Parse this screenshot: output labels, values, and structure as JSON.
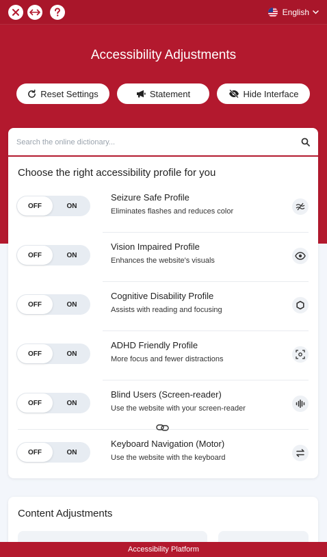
{
  "header": {
    "language_label": "English"
  },
  "title": "Accessibility Adjustments",
  "actions": {
    "reset_label": "Reset Settings",
    "statement_label": "Statement",
    "hide_label": "Hide Interface"
  },
  "search": {
    "placeholder": "Search the online dictionary..."
  },
  "profiles_section": {
    "title": "Choose the right accessibility profile for you",
    "profiles": [
      {
        "title": "Seizure Safe Profile",
        "description": "Eliminates flashes and reduces color",
        "off_label": "OFF",
        "on_label": "ON",
        "icon": "waves-icon"
      },
      {
        "title": "Vision Impaired Profile",
        "description": "Enhances the website's visuals",
        "off_label": "OFF",
        "on_label": "ON",
        "icon": "eye-icon"
      },
      {
        "title": "Cognitive Disability Profile",
        "description": "Assists with reading and focusing",
        "off_label": "OFF",
        "on_label": "ON",
        "icon": "circle-icon"
      },
      {
        "title": "ADHD Friendly Profile",
        "description": "More focus and fewer distractions",
        "off_label": "OFF",
        "on_label": "ON",
        "icon": "focus-icon"
      },
      {
        "title": "Blind Users (Screen-reader)",
        "description": "Use the website with your screen-reader",
        "off_label": "OFF",
        "on_label": "ON",
        "icon": "audio-bars-icon"
      },
      {
        "title": "Keyboard Navigation (Motor)",
        "description": "Use the website with the keyboard",
        "off_label": "OFF",
        "on_label": "ON",
        "icon": "arrows-icon"
      }
    ]
  },
  "content_section": {
    "title": "Content Adjustments"
  },
  "footer": {
    "label": "Accessibility Platform"
  },
  "colors": {
    "brand": "#b3192e",
    "page_bg": "#f3f6fb"
  }
}
